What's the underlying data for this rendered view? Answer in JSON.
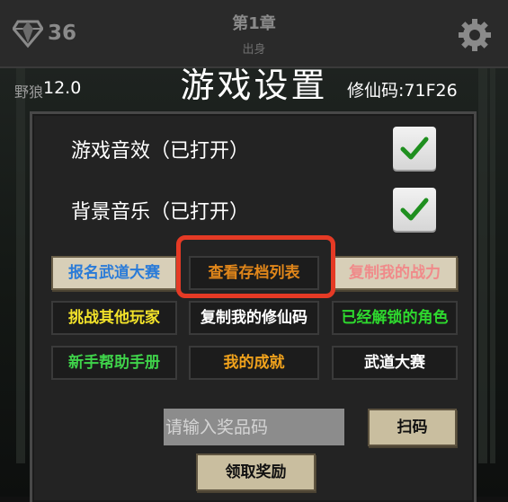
{
  "header": {
    "gem_count": "36",
    "chapter": "第1章",
    "subtitle": "出身",
    "icons": [
      "diamond-icon",
      "gear-icon"
    ]
  },
  "background": {
    "scene_label": "野狼",
    "version": "12.0"
  },
  "dialog": {
    "title": "游戏设置",
    "code_label": "修仙码:71F26",
    "toggles": [
      {
        "label": "游戏音效（已打开）",
        "checked": true
      },
      {
        "label": "背景音乐（已打开）",
        "checked": true
      }
    ],
    "buttons": [
      {
        "label": "报名武道大赛",
        "color": "#2a7bd8"
      },
      {
        "label": "查看存档列表",
        "color": "#e0861a"
      },
      {
        "label": "复制我的战力",
        "color": "#f08a8a"
      },
      {
        "label": "挑战其他玩家",
        "color": "#f2e22a"
      },
      {
        "label": "复制我的修仙码",
        "color": "#ffffff"
      },
      {
        "label": "已经解锁的角色",
        "color": "#2ed82e"
      },
      {
        "label": "新手帮助手册",
        "color": "#3fd24a"
      },
      {
        "label": "我的成就",
        "color": "#f0a21c"
      },
      {
        "label": "武道大赛",
        "color": "#ffffff"
      }
    ],
    "prize_input_placeholder": "请输入奖品码",
    "scan_label": "扫码",
    "claim_label": "领取奖励"
  },
  "colors": {
    "highlight": "#e53a25",
    "checkmark": "#1f8f1f"
  }
}
